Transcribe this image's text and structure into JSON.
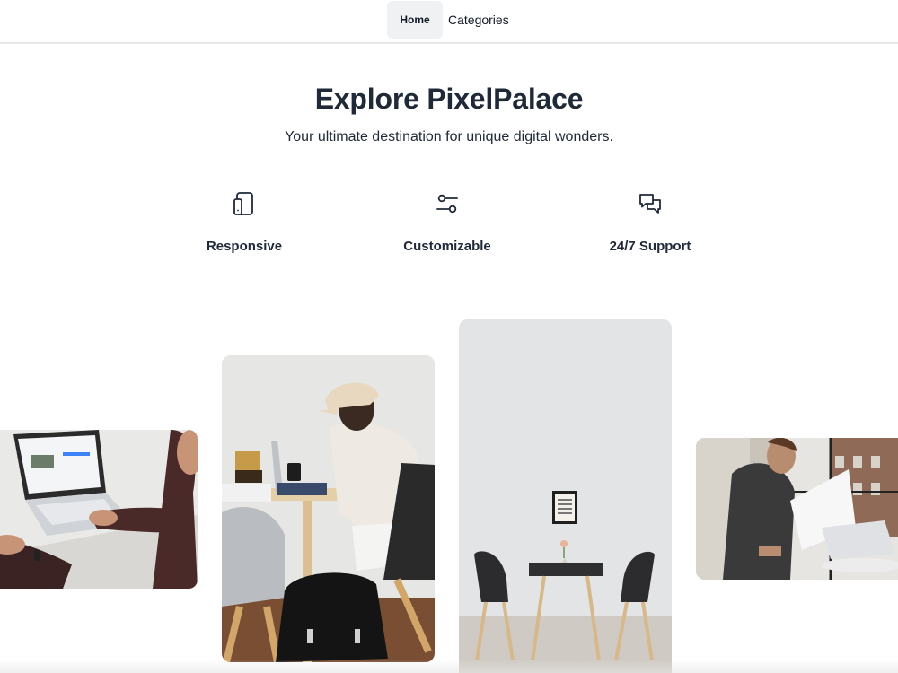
{
  "nav": {
    "items": [
      {
        "label": "Home",
        "active": true
      },
      {
        "label": "Categories",
        "active": false
      }
    ]
  },
  "hero": {
    "title": "Explore PixelPalace",
    "subtitle": "Your ultimate destination for unique digital wonders."
  },
  "features": [
    {
      "icon": "tablet-icon",
      "label": "Responsive"
    },
    {
      "icon": "sliders-icon",
      "label": "Customizable"
    },
    {
      "icon": "chat-bubbles-icon",
      "label": "24/7 Support"
    }
  ],
  "gallery": [
    {
      "name": "laptop-desk-photo",
      "subject": "person using laptop at desk"
    },
    {
      "name": "person-working-photo",
      "subject": "person working on laptop at wooden desk"
    },
    {
      "name": "cafe-table-photo",
      "subject": "table with two chairs against white wall"
    },
    {
      "name": "man-with-tablet-photo",
      "subject": "man using tablet device by window"
    }
  ],
  "colors": {
    "text": "#1f2937",
    "nav_active_bg": "#f0f1f3",
    "divider": "#e5e7eb"
  }
}
